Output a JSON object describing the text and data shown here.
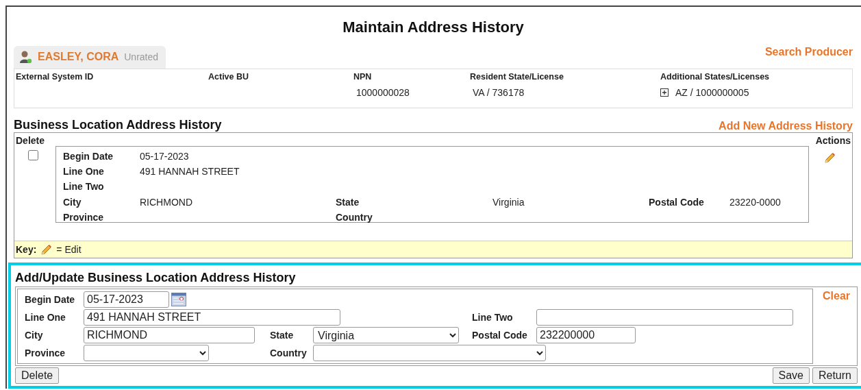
{
  "title": "Maintain Address History",
  "producer": {
    "name": "EASLEY, CORA",
    "rating": "Unrated"
  },
  "search_link": "Search Producer",
  "info": [
    {
      "label": "External System ID"
    },
    {
      "label": "Active BU"
    },
    {
      "label": "NPN",
      "value": "1000000028",
      "kind": "plain"
    },
    {
      "label": "Resident State/License",
      "value": "VA / 736178",
      "kind": "plain"
    },
    {
      "label": "Additional States/Licenses",
      "value": "AZ / 1000000005",
      "kind": "expandable"
    }
  ],
  "history": {
    "title": "Business Location Address History",
    "add_link": "Add New Address History",
    "delete_header": "Delete",
    "actions_header": "Actions",
    "rows": [
      {
        "checked": false,
        "lines": [
          [
            {
              "label": "Begin Date",
              "value": "05-17-2023"
            }
          ],
          [
            {
              "label": "Line One",
              "value": "491 HANNAH STREET"
            }
          ],
          [
            {
              "label": "Line Two"
            }
          ],
          [
            {
              "label": "City",
              "value": "RICHMOND"
            },
            {
              "label": "State",
              "value": "Virginia"
            },
            {
              "label": "Postal Code",
              "value": "23220-0000"
            }
          ],
          [
            {
              "label": "Province"
            },
            {
              "label": "Country"
            }
          ]
        ]
      }
    ],
    "key": {
      "label": "Key:",
      "text": "= Edit"
    }
  },
  "form": {
    "title": "Add/Update Business Location Address History",
    "clear": "Clear",
    "rows": [
      [
        {
          "label": "Begin Date",
          "kind": "date",
          "value": "05-17-2023"
        }
      ],
      [
        {
          "label": "Line One",
          "kind": "text",
          "value": "491 HANNAH STREET"
        },
        null,
        {
          "label": "Line Two",
          "kind": "text"
        }
      ],
      [
        {
          "label": "City",
          "kind": "text",
          "value": "RICHMOND"
        },
        {
          "label": "State",
          "kind": "select",
          "value": "Virginia"
        },
        {
          "label": "Postal Code",
          "kind": "text",
          "value": "232200000"
        }
      ],
      [
        {
          "label": "Province",
          "kind": "select"
        },
        {
          "label": "Country",
          "kind": "select"
        }
      ]
    ]
  },
  "buttons": {
    "left": [
      "Delete"
    ],
    "right": [
      "Save",
      "Return"
    ]
  }
}
